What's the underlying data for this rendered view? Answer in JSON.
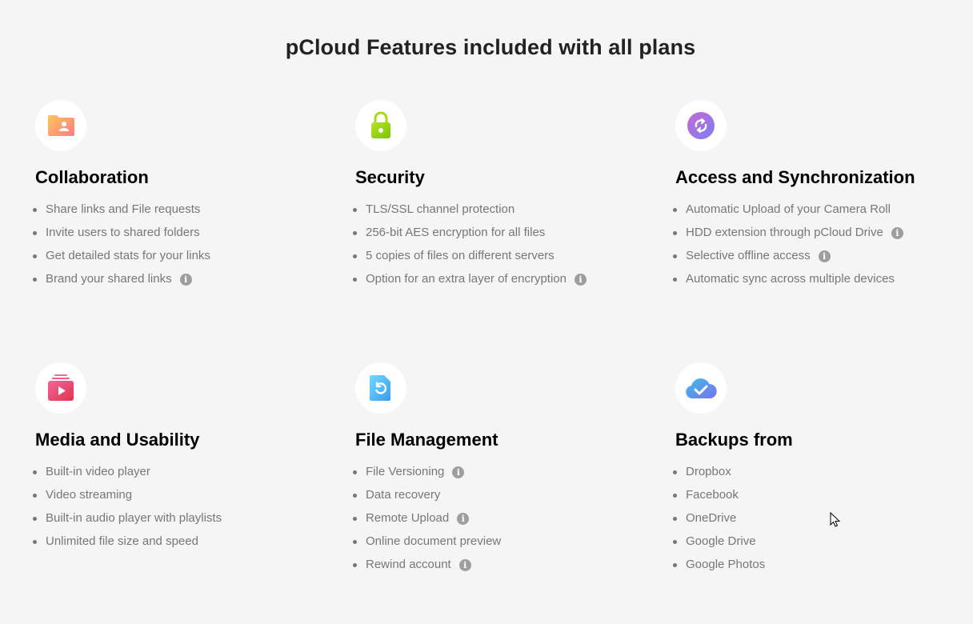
{
  "page": {
    "title": "pCloud Features included with all plans"
  },
  "features": [
    {
      "title": "Collaboration",
      "icon": "folder-user-icon",
      "items": [
        {
          "label": "Share links and File requests",
          "info": false
        },
        {
          "label": "Invite users to shared folders",
          "info": false
        },
        {
          "label": "Get detailed stats for your links",
          "info": false
        },
        {
          "label": "Brand your shared links",
          "info": true
        }
      ]
    },
    {
      "title": "Security",
      "icon": "lock-icon",
      "items": [
        {
          "label": "TLS/SSL channel protection",
          "info": false
        },
        {
          "label": "256-bit AES encryption for all files",
          "info": false
        },
        {
          "label": "5 copies of files on different servers",
          "info": false
        },
        {
          "label": "Option for an extra layer of encryption",
          "info": true
        }
      ]
    },
    {
      "title": "Access and Synchronization",
      "icon": "sync-icon",
      "items": [
        {
          "label": "Automatic Upload of your Camera Roll",
          "info": false
        },
        {
          "label": "HDD extension through pCloud Drive",
          "info": true
        },
        {
          "label": "Selective offline access",
          "info": true
        },
        {
          "label": "Automatic sync across multiple devices",
          "info": false
        }
      ]
    },
    {
      "title": "Media and Usability",
      "icon": "media-play-icon",
      "items": [
        {
          "label": "Built-in video player",
          "info": false
        },
        {
          "label": "Video streaming",
          "info": false
        },
        {
          "label": "Built-in audio player with playlists",
          "info": false
        },
        {
          "label": "Unlimited file size and speed",
          "info": false
        }
      ]
    },
    {
      "title": "File Management",
      "icon": "file-restore-icon",
      "items": [
        {
          "label": "File Versioning",
          "info": true
        },
        {
          "label": "Data recovery",
          "info": false
        },
        {
          "label": "Remote Upload",
          "info": true
        },
        {
          "label": "Online document preview",
          "info": false
        },
        {
          "label": "Rewind account",
          "info": true
        }
      ]
    },
    {
      "title": "Backups from",
      "icon": "cloud-check-icon",
      "items": [
        {
          "label": "Dropbox",
          "info": false
        },
        {
          "label": "Facebook",
          "info": false
        },
        {
          "label": "OneDrive",
          "info": false
        },
        {
          "label": "Google Drive",
          "info": false
        },
        {
          "label": "Google Photos",
          "info": false
        }
      ]
    }
  ],
  "info_glyph": "i",
  "colors": {
    "background": "#f5f5f5",
    "title": "#222222",
    "heading": "#000000",
    "text": "#777777",
    "info": "#9e9e9e"
  }
}
